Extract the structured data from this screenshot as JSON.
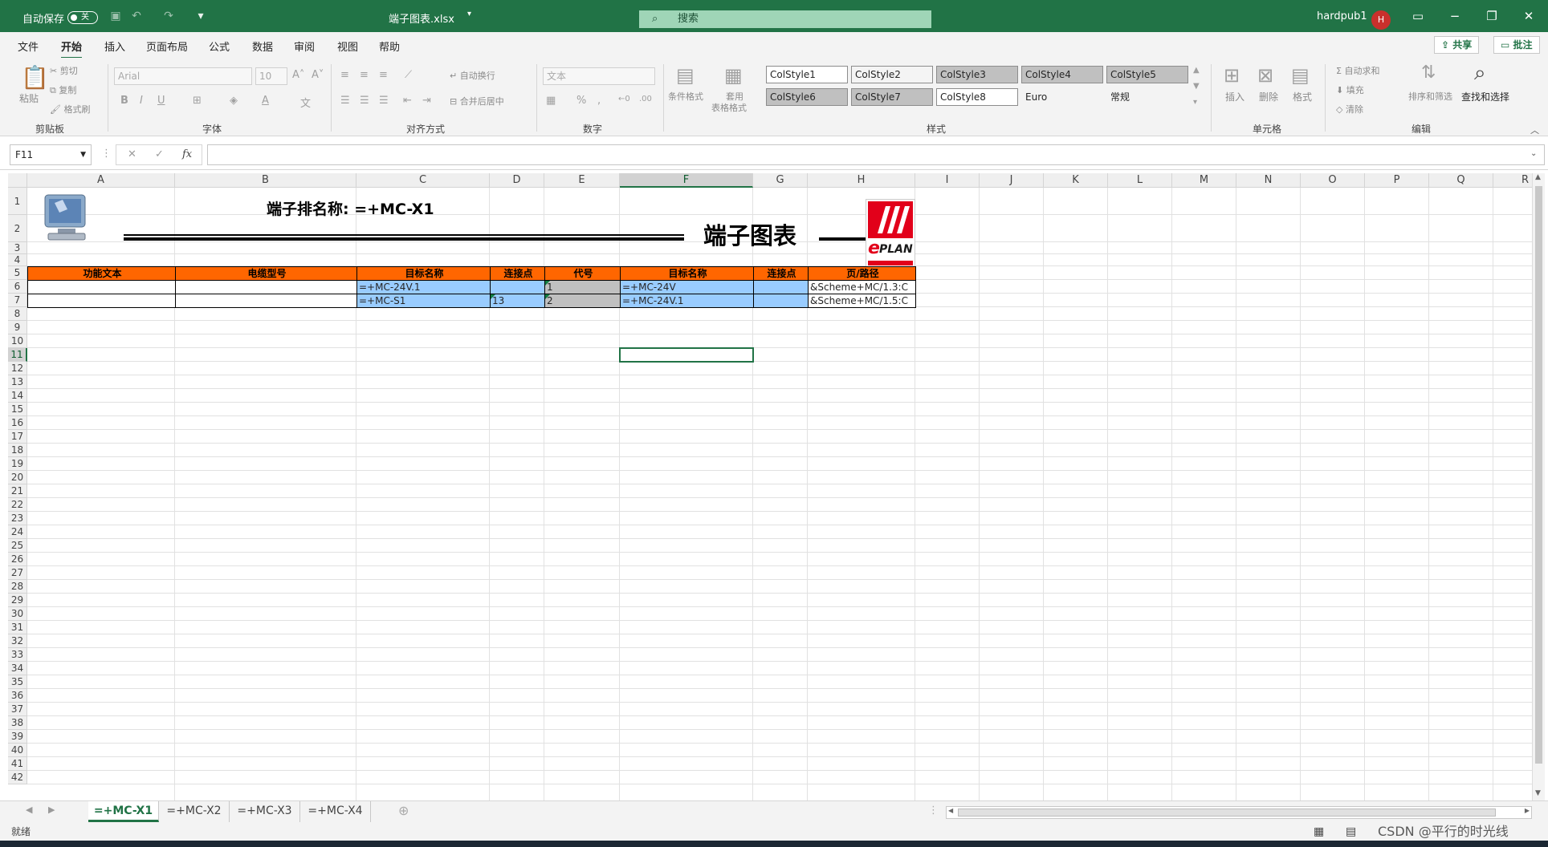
{
  "titlebar": {
    "autosave_label": "自动保存",
    "autosave_state": "关",
    "filename": "端子图表.xlsx",
    "search_placeholder": "搜索",
    "user": "hardpub1",
    "avatar_initial": "H",
    "accent_color": "#217346"
  },
  "menu": {
    "tabs": [
      "文件",
      "开始",
      "插入",
      "页面布局",
      "公式",
      "数据",
      "审阅",
      "视图",
      "帮助"
    ],
    "active_tab": "开始",
    "share_label": "共享",
    "comments_label": "批注"
  },
  "ribbon": {
    "clipboard": {
      "paste": "粘贴",
      "cut": "剪切",
      "copy": "复制",
      "format_painter": "格式刷",
      "group": "剪贴板"
    },
    "font": {
      "font_name": "Arial",
      "font_size": "10",
      "group": "字体"
    },
    "alignment": {
      "wrap_text": "自动换行",
      "merge_center": "合并后居中",
      "group": "对齐方式"
    },
    "number": {
      "format": "文本",
      "group": "数字"
    },
    "styles": {
      "conditional": "条件格式",
      "table_format_1": "套用",
      "table_format_2": "表格格式",
      "cells": [
        "ColStyle1",
        "ColStyle2",
        "ColStyle3",
        "ColStyle4",
        "ColStyle5",
        "ColStyle6",
        "ColStyle7",
        "ColStyle8",
        "Euro",
        "常规"
      ],
      "group": "样式"
    },
    "cells": {
      "insert": "插入",
      "delete": "删除",
      "format": "格式",
      "group": "单元格"
    },
    "editing": {
      "autosum": "自动求和",
      "fill": "填充",
      "clear": "清除",
      "sort_filter": "排序和筛选",
      "find_select": "查找和选择",
      "group": "编辑"
    }
  },
  "formula_bar": {
    "name_box": "F11",
    "fx": "fx",
    "content": ""
  },
  "sheet": {
    "columns": [
      "A",
      "B",
      "C",
      "D",
      "E",
      "F",
      "G",
      "H",
      "I",
      "J",
      "K",
      "L",
      "M",
      "N",
      "O",
      "P",
      "Q",
      "R"
    ],
    "rows": [
      "1",
      "2",
      "3",
      "4",
      "5",
      "6",
      "7",
      "8",
      "9",
      "10",
      "11",
      "12",
      "13",
      "14",
      "15",
      "16",
      "17",
      "18",
      "19",
      "20",
      "21",
      "22",
      "23",
      "24",
      "25",
      "26",
      "27",
      "28",
      "29",
      "30",
      "31",
      "32",
      "33",
      "34",
      "35",
      "36",
      "37",
      "38",
      "39",
      "40",
      "41",
      "42"
    ],
    "selected_cell": "F11",
    "title": "端子排名称: =+MC-X1",
    "heading": "端子图表",
    "logo_text": "PLAN",
    "logo_e": "e",
    "header_row": [
      "功能文本",
      "电缆型号",
      "目标名称",
      "连接点",
      "代号",
      "目标名称",
      "连接点",
      "页/路径"
    ],
    "data_rows": [
      [
        "",
        "",
        "=+MC-24V.1",
        "",
        "1",
        "=+MC-24V",
        "",
        "&Scheme+MC/1.3:C"
      ],
      [
        "",
        "",
        "=+MC-S1",
        "13",
        "2",
        "=+MC-24V.1",
        "",
        "&Scheme+MC/1.5:C"
      ]
    ]
  },
  "sheet_tabs": [
    "=+MC-X1",
    "=+MC-X2",
    "=+MC-X3",
    "=+MC-X4"
  ],
  "active_sheet": "=+MC-X1",
  "status": {
    "ready": "就绪",
    "watermark": "CSDN @平行的时光线"
  }
}
